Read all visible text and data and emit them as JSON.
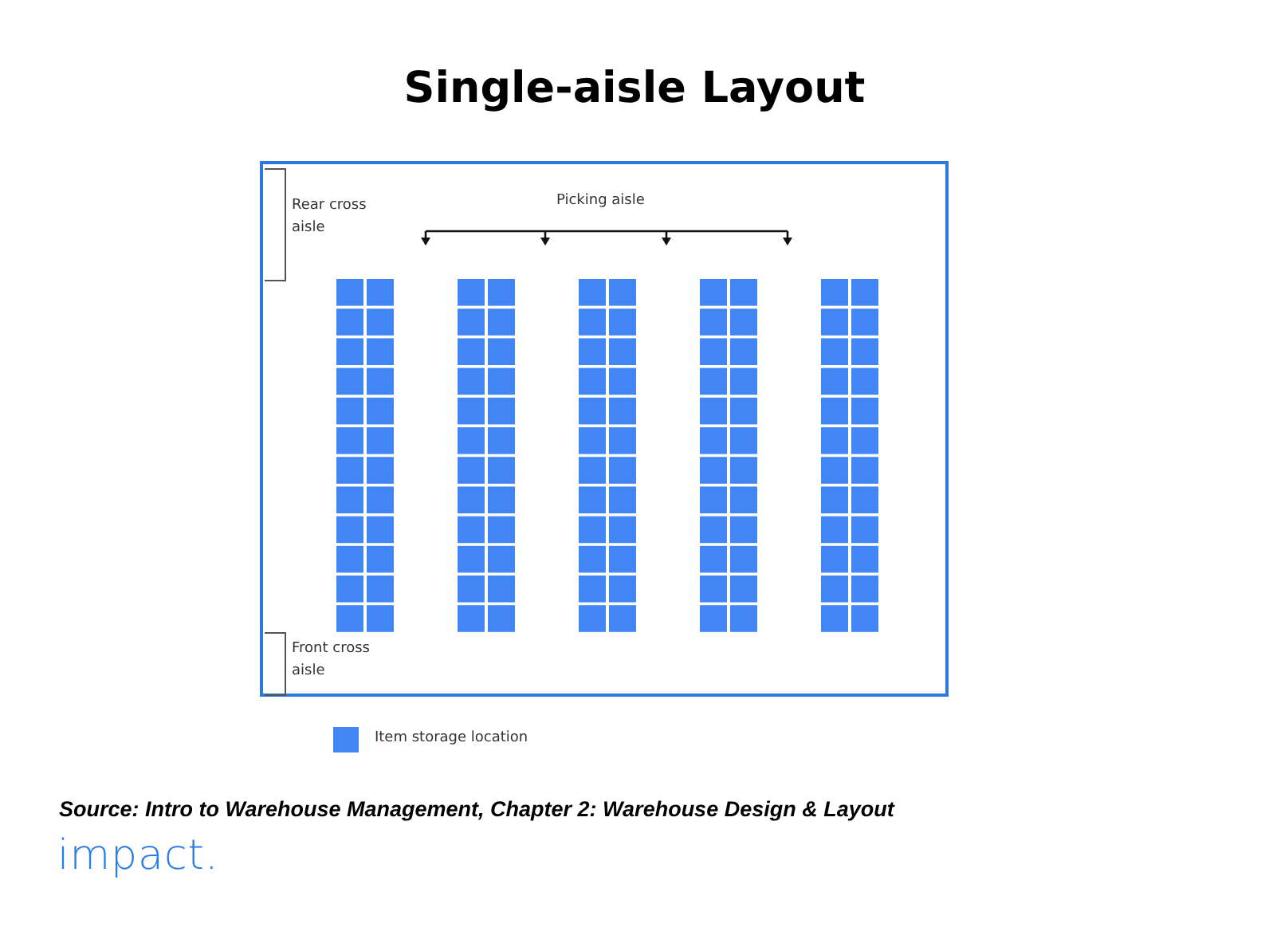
{
  "title": "Single-aisle Layout",
  "diagram": {
    "rear_cross_aisle": "Rear cross aisle",
    "picking_aisle": "Picking aisle",
    "front_cross_aisle": "Front cross aisle"
  },
  "legend": {
    "label": "Item storage location"
  },
  "source": "Source: Intro to Warehouse Management, Chapter 2: Warehouse Design & Layout",
  "logo": "impact."
}
